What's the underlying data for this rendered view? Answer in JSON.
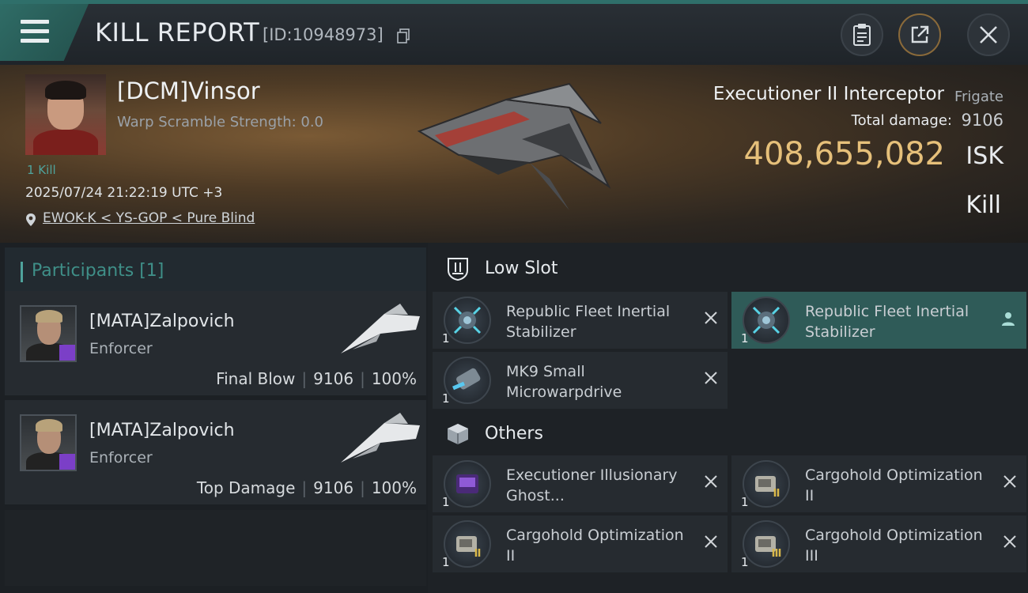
{
  "header": {
    "title": "KILL REPORT",
    "report_id": "[ID:10948973]"
  },
  "victim": {
    "name": "[DCM]Vinsor",
    "warp_scramble": "Warp Scramble Strength: 0.0",
    "kills": "1 Kill",
    "timestamp": "2025/07/24 21:22:19 UTC +3",
    "location": "EWOK-K < YS-GOP < Pure Blind",
    "ship_name": "Executioner II Interceptor",
    "ship_class": "Frigate",
    "total_damage_label": "Total damage:",
    "total_damage": "9106",
    "isk_value": "408,655,082",
    "isk_unit": "ISK",
    "outcome": "Kill"
  },
  "participants": {
    "title": "Participants [1]",
    "items": [
      {
        "name": "[MATA]Zalpovich",
        "role": "Enforcer",
        "label": "Final Blow",
        "damage": "9106",
        "percent": "100%"
      },
      {
        "name": "[MATA]Zalpovich",
        "role": "Enforcer",
        "label": "Top Damage",
        "damage": "9106",
        "percent": "100%"
      }
    ]
  },
  "fittings": {
    "low_slot": {
      "title": "Low Slot",
      "items": [
        {
          "name": "Republic Fleet Inertial Stabilizer",
          "qty": "1",
          "status": "destroyed"
        },
        {
          "name": "Republic Fleet Inertial Stabilizer",
          "qty": "1",
          "status": "dropped"
        },
        {
          "name": "MK9 Small Microwarpdrive",
          "qty": "1",
          "status": "destroyed"
        }
      ]
    },
    "others": {
      "title": "Others",
      "items": [
        {
          "name": "Executioner Illusionary Ghost...",
          "qty": "1",
          "status": "destroyed"
        },
        {
          "name": "Cargohold Optimization II",
          "qty": "1",
          "status": "destroyed"
        },
        {
          "name": "Cargohold Optimization II",
          "qty": "1",
          "status": "destroyed"
        },
        {
          "name": "Cargohold Optimization III",
          "qty": "1",
          "status": "destroyed"
        }
      ]
    }
  },
  "colors": {
    "accent": "#2f6c66",
    "isk": "#e6c07a",
    "highlight": "#2f5b58"
  },
  "icons": [
    "menu-icon",
    "copy-icon",
    "clipboard-icon",
    "share-icon",
    "close-icon",
    "location-pin-icon",
    "low-slot-icon",
    "cube-icon",
    "destroyed-x-icon",
    "person-icon"
  ]
}
